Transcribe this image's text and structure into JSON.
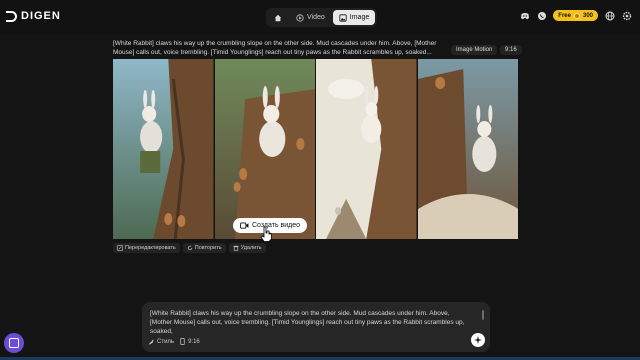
{
  "header": {
    "brand": "DIGEN",
    "tabs": [
      {
        "label": "",
        "icon": "home-icon"
      },
      {
        "label": "Video",
        "icon": "video-icon"
      },
      {
        "label": "Image",
        "icon": "image-icon",
        "active": true
      }
    ],
    "free_label": "Free",
    "credits": "300",
    "icons": [
      "discord-icon",
      "whatsapp-icon",
      "globe-icon",
      "settings-icon"
    ]
  },
  "result": {
    "prompt": "[White Rabbit] claws his way up the crumbling slope on the other side. Mud cascades under him. Above, [Mother Mouse] calls out, voice trembling. [Timid Younglings] reach out tiny paws as the Rabbit scrambles up, soaked...",
    "mode_tag": "Image Motion",
    "ratio_tag": "9:16",
    "create_video_label": "Создать видео",
    "actions": [
      {
        "label": "Перередактировать",
        "icon": "edit-icon"
      },
      {
        "label": "Повторить",
        "icon": "refresh-icon"
      },
      {
        "label": "Удалить",
        "icon": "trash-icon"
      }
    ]
  },
  "composer": {
    "text": "[White Rabbit] claws his way up the crumbling slope on the other side. Mud cascades under him. Above, [Mother Mouse] calls out, voice trembling. [Timid Younglings] reach out tiny paws as the Rabbit scrambles up, soaked,",
    "style_label": "Стиль",
    "ratio_label": "9:16"
  },
  "colors": {
    "accent": "#f3c21d",
    "chat_button": "#6c4cd6",
    "background": "#141414"
  }
}
